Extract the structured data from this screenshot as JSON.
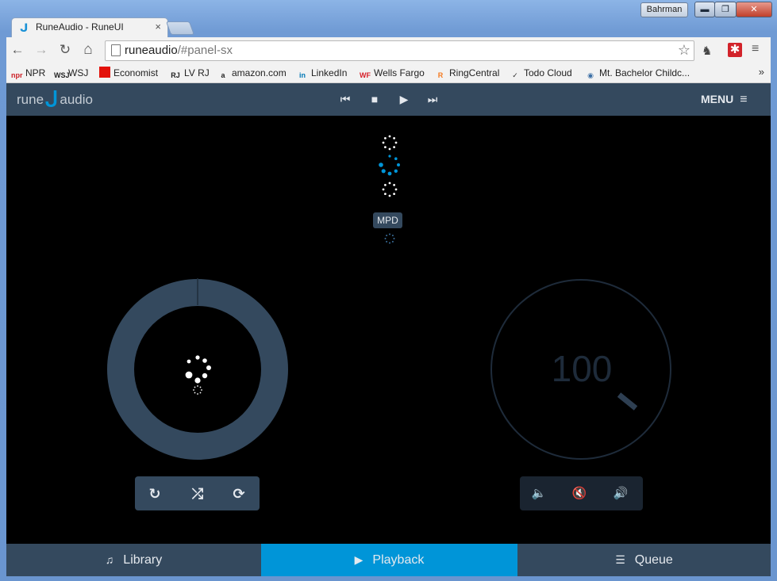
{
  "window": {
    "user": "Bahrman",
    "min_glyph": "▬",
    "max_glyph": "❐",
    "close_glyph": "✕"
  },
  "tab": {
    "title": "RuneAudio - RuneUI",
    "favicon": "ᒍ",
    "close": "×"
  },
  "toolbar": {
    "back": "←",
    "forward": "→",
    "reload": "↻",
    "home": "⌂",
    "url_host": "runeaudio",
    "url_path": "/#panel-sx",
    "star": "☆",
    "ext1": "♞",
    "ext2": "✱",
    "menu": "≡"
  },
  "bookmarks": [
    {
      "label": "NPR",
      "icon": "npr",
      "color": "#cc2027"
    },
    {
      "label": "WSJ",
      "icon": "WSJ",
      "color": "#222222"
    },
    {
      "label": "Economist",
      "icon": "",
      "color": "#e3120b"
    },
    {
      "label": "LV RJ",
      "icon": "RJ",
      "color": "#222222"
    },
    {
      "label": "amazon.com",
      "icon": "a",
      "color": "#222222"
    },
    {
      "label": "LinkedIn",
      "icon": "in",
      "color": "#0077b5"
    },
    {
      "label": "Wells Fargo",
      "icon": "WF",
      "color": "#d71e28"
    },
    {
      "label": "RingCentral",
      "icon": "R",
      "color": "#f47a20"
    },
    {
      "label": "Todo Cloud",
      "icon": "✓",
      "color": "#333333"
    },
    {
      "label": "Mt. Bachelor Childc...",
      "icon": "◉",
      "color": "#3a6ea5"
    }
  ],
  "bookmarks_more": "»",
  "app": {
    "logo_left": "rune",
    "logo_mark": "ᒍ",
    "logo_right": "audio",
    "transport": {
      "prev": "⏮",
      "stop": "■",
      "play": "▶",
      "next": "⏭"
    },
    "menu_label": "MENU",
    "menu_icon": "≡",
    "mpd_badge": "MPD",
    "volume": "100",
    "left_controls": {
      "repeat": "↻",
      "shuffle": "⤮",
      "single": "⟳"
    },
    "right_controls": {
      "vol_down": "🔈",
      "mute": "🔇",
      "vol_up": "🔊"
    },
    "footer": {
      "library": {
        "icon": "♫",
        "label": "Library"
      },
      "playback": {
        "icon": "▶",
        "label": "Playback"
      },
      "queue": {
        "icon": "☰",
        "label": "Queue"
      }
    },
    "colors": {
      "header": "#34495e",
      "accent": "#0095d8",
      "background": "#000000"
    }
  }
}
